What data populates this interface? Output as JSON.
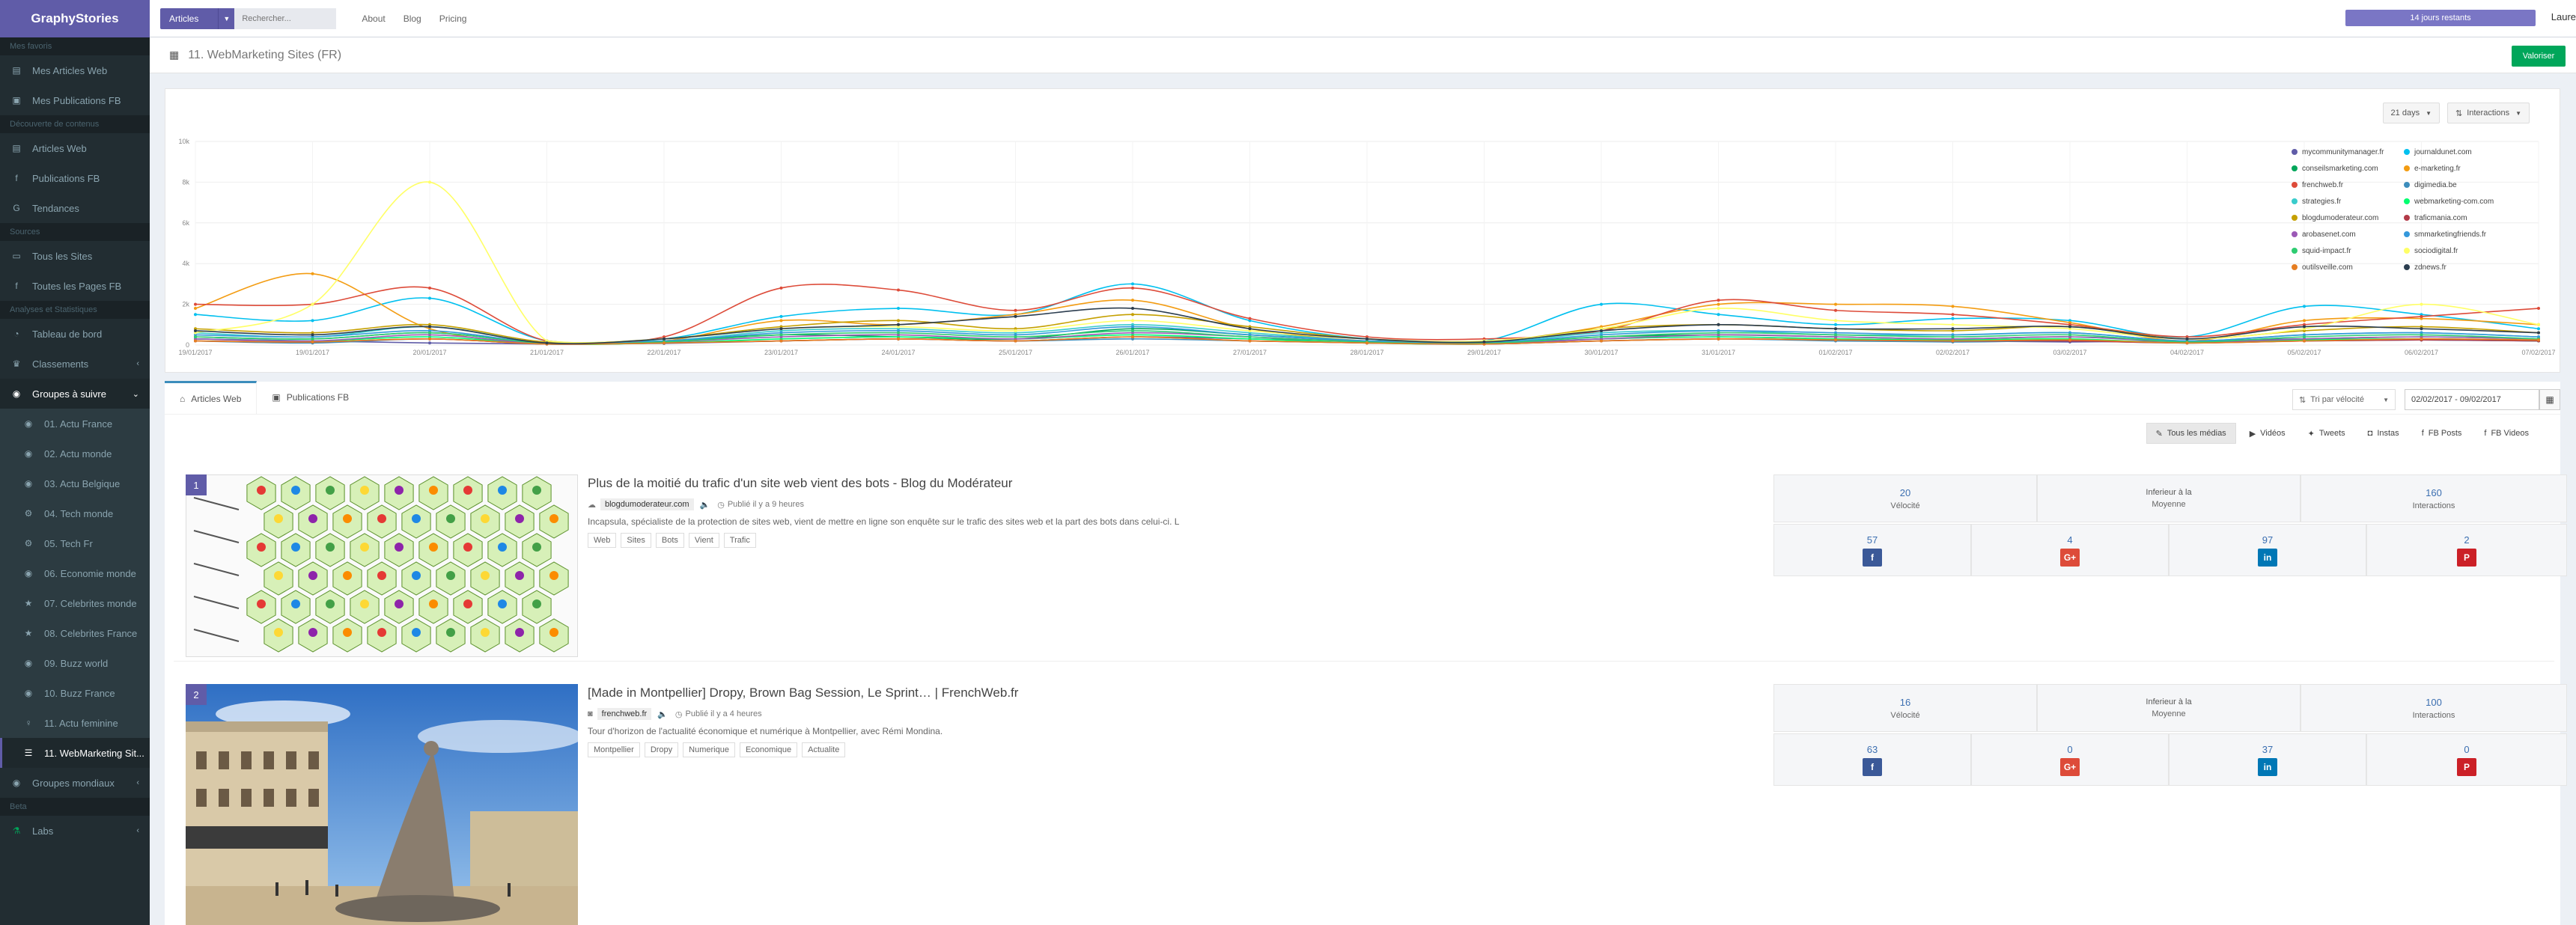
{
  "app": {
    "title": "GraphyStories"
  },
  "sidebar": {
    "sections": [
      {
        "header": "Mes favoris",
        "items": [
          {
            "label": "Mes Articles Web",
            "icon": "newspaper-icon"
          },
          {
            "label": "Mes Publications FB",
            "icon": "facebook-square-icon"
          }
        ]
      },
      {
        "header": "Découverte de contenus",
        "items": [
          {
            "label": "Articles Web",
            "icon": "newspaper-icon"
          },
          {
            "label": "Publications FB",
            "icon": "facebook-icon"
          },
          {
            "label": "Tendances",
            "icon": "google-icon"
          }
        ]
      },
      {
        "header": "Sources",
        "items": [
          {
            "label": "Tous les Sites",
            "icon": "monitor-icon"
          },
          {
            "label": "Toutes les Pages FB",
            "icon": "facebook-icon"
          }
        ]
      },
      {
        "header": "Analyses et Statistiques",
        "items": [
          {
            "label": "Tableau de bord",
            "icon": "dashboard-icon"
          },
          {
            "label": "Classements",
            "icon": "trophy-icon"
          },
          {
            "label": "Groupes à suivre",
            "icon": "globe-icon"
          }
        ]
      }
    ],
    "groups": [
      {
        "label": "01. Actu France",
        "icon": "globe-icon"
      },
      {
        "label": "02. Actu monde",
        "icon": "globe-icon"
      },
      {
        "label": "03. Actu Belgique",
        "icon": "globe-icon"
      },
      {
        "label": "04. Tech monde",
        "icon": "gear-icon"
      },
      {
        "label": "05. Tech Fr",
        "icon": "gear-icon"
      },
      {
        "label": "06. Economie monde",
        "icon": "globe-icon"
      },
      {
        "label": "07. Celebrites monde",
        "icon": "star-icon"
      },
      {
        "label": "08. Celebrites France",
        "icon": "star-icon"
      },
      {
        "label": "09. Buzz world",
        "icon": "globe-icon"
      },
      {
        "label": "10. Buzz France",
        "icon": "globe-icon"
      },
      {
        "label": "11. Actu feminine",
        "icon": "female-icon"
      },
      {
        "label": "11. WebMarketing Sit...",
        "icon": "list-icon"
      }
    ],
    "after": [
      {
        "label": "Groupes mondiaux",
        "icon": "globe-icon"
      }
    ],
    "beta_header": "Beta",
    "beta_items": [
      {
        "label": "Labs",
        "icon": "flask-icon"
      }
    ]
  },
  "topbar": {
    "dropdown_label": "Articles",
    "search_placeholder": "Rechercher...",
    "links": [
      "About",
      "Blog",
      "Pricing"
    ],
    "badge": "14 jours restants",
    "user": "Laure"
  },
  "page": {
    "title": "11. WebMarketing Sites (FR)",
    "valoriser": "Valoriser"
  },
  "chart_controls": {
    "range": "21 days",
    "metric": "Interactions"
  },
  "chart_data": {
    "type": "line",
    "x": [
      "19/01/2017",
      "19/01/2017",
      "20/01/2017",
      "21/01/2017",
      "22/01/2017",
      "23/01/2017",
      "24/01/2017",
      "25/01/2017",
      "26/01/2017",
      "27/01/2017",
      "28/01/2017",
      "29/01/2017",
      "30/01/2017",
      "31/01/2017",
      "01/02/2017",
      "02/02/2017",
      "03/02/2017",
      "04/02/2017",
      "05/02/2017",
      "06/02/2017",
      "07/02/2017"
    ],
    "yticks": [
      "0",
      "2k",
      "4k",
      "6k",
      "8k",
      "10k"
    ],
    "ylim": [
      0,
      10000
    ],
    "grid": true,
    "legend_placement": "top-right",
    "series": [
      {
        "name": "mycommunitymanager.fr",
        "color": "#605ca8",
        "values": [
          300,
          200,
          100,
          50,
          80,
          200,
          300,
          200,
          400,
          300,
          200,
          100,
          300,
          400,
          300,
          200,
          150,
          200,
          300,
          250,
          200
        ]
      },
      {
        "name": "journaldunet.com",
        "color": "#00c0ef",
        "values": [
          1500,
          1200,
          2300,
          200,
          300,
          1400,
          1800,
          1500,
          3000,
          1200,
          300,
          200,
          2000,
          1500,
          1000,
          1300,
          1200,
          400,
          1900,
          1500,
          800
        ]
      },
      {
        "name": "conseilsmarketing.com",
        "color": "#00a65a",
        "values": [
          400,
          300,
          600,
          100,
          200,
          500,
          400,
          300,
          800,
          500,
          200,
          100,
          400,
          500,
          400,
          300,
          400,
          200,
          300,
          400,
          300
        ]
      },
      {
        "name": "e-marketing.fr",
        "color": "#f39c12",
        "values": [
          1800,
          3500,
          800,
          100,
          200,
          1200,
          1000,
          1500,
          2200,
          800,
          200,
          100,
          900,
          2000,
          2000,
          1900,
          1100,
          200,
          1200,
          1300,
          1000
        ]
      },
      {
        "name": "frenchweb.fr",
        "color": "#dd4b39",
        "values": [
          2000,
          2000,
          2800,
          200,
          400,
          2800,
          2700,
          1700,
          2800,
          1300,
          400,
          300,
          700,
          2200,
          1700,
          1500,
          1000,
          400,
          1000,
          1400,
          1800
        ]
      },
      {
        "name": "digimedia.be",
        "color": "#3c8dbc",
        "values": [
          200,
          100,
          300,
          50,
          100,
          200,
          300,
          200,
          300,
          200,
          100,
          50,
          200,
          300,
          200,
          150,
          200,
          100,
          200,
          250,
          200
        ]
      },
      {
        "name": "strategies.fr",
        "color": "#39cccc",
        "values": [
          600,
          400,
          900,
          100,
          200,
          700,
          800,
          600,
          1000,
          600,
          200,
          100,
          600,
          700,
          500,
          500,
          600,
          200,
          500,
          600,
          400
        ]
      },
      {
        "name": "webmarketing-com.com",
        "color": "#01ff70",
        "values": [
          300,
          200,
          400,
          50,
          100,
          300,
          400,
          300,
          500,
          300,
          100,
          50,
          300,
          400,
          300,
          250,
          300,
          100,
          250,
          300,
          200
        ]
      },
      {
        "name": "blogdumoderateur.com",
        "color": "#c5a000",
        "values": [
          800,
          600,
          1000,
          150,
          300,
          900,
          1200,
          800,
          1500,
          900,
          300,
          150,
          800,
          1000,
          800,
          700,
          900,
          300,
          700,
          900,
          600
        ]
      },
      {
        "name": "traficmania.com",
        "color": "#b23a48",
        "values": [
          200,
          150,
          300,
          50,
          100,
          200,
          300,
          200,
          400,
          200,
          100,
          50,
          200,
          300,
          250,
          200,
          200,
          100,
          200,
          250,
          200
        ]
      },
      {
        "name": "arobasenet.com",
        "color": "#9b59b6",
        "values": [
          300,
          200,
          500,
          50,
          150,
          400,
          500,
          300,
          600,
          400,
          150,
          50,
          300,
          500,
          400,
          300,
          400,
          150,
          300,
          400,
          300
        ]
      },
      {
        "name": "smmarketingfriends.fr",
        "color": "#3498db",
        "values": [
          500,
          400,
          700,
          100,
          200,
          600,
          700,
          500,
          900,
          500,
          200,
          100,
          500,
          700,
          600,
          500,
          600,
          200,
          500,
          600,
          400
        ]
      },
      {
        "name": "squid-impact.fr",
        "color": "#2ecc71",
        "values": [
          400,
          300,
          600,
          80,
          150,
          500,
          600,
          400,
          700,
          400,
          150,
          80,
          400,
          600,
          500,
          400,
          500,
          150,
          400,
          500,
          300
        ]
      },
      {
        "name": "sociodigital.fr",
        "color": "#ffff66",
        "values": [
          600,
          2000,
          8000,
          200,
          300,
          800,
          900,
          700,
          1200,
          700,
          300,
          200,
          800,
          1800,
          1200,
          1000,
          800,
          300,
          800,
          2000,
          1000
        ]
      },
      {
        "name": "outilsveille.com",
        "color": "#e67e22",
        "values": [
          200,
          150,
          300,
          50,
          100,
          200,
          300,
          200,
          400,
          200,
          100,
          50,
          200,
          300,
          250,
          200,
          250,
          100,
          200,
          300,
          250
        ]
      },
      {
        "name": "zdnews.fr",
        "color": "#2c3e50",
        "values": [
          700,
          500,
          900,
          100,
          300,
          800,
          1000,
          1400,
          1800,
          800,
          300,
          150,
          700,
          1000,
          800,
          800,
          900,
          300,
          900,
          800,
          600
        ]
      }
    ]
  },
  "tabs": {
    "items": [
      {
        "label": "Articles Web",
        "icon": "home-icon"
      },
      {
        "label": "Publications FB",
        "icon": "facebook-square-icon"
      }
    ],
    "sort_label": "Tri par vélocité",
    "date_range": "02/02/2017 - 09/02/2017"
  },
  "filters": [
    {
      "label": "Tous les médias",
      "icon": "wrench-icon"
    },
    {
      "label": "Vidéos",
      "icon": "video-icon"
    },
    {
      "label": "Tweets",
      "icon": "twitter-icon"
    },
    {
      "label": "Instas",
      "icon": "instagram-icon"
    },
    {
      "label": "FB Posts",
      "icon": "facebook-icon"
    },
    {
      "label": "FB Videos",
      "icon": "facebook-icon"
    }
  ],
  "articles": [
    {
      "rank": "1",
      "title": "Plus de la moitié du trafic d'un site web vient des bots - Blog du Modérateur",
      "domain": "blogdumoderateur.com",
      "time": "Publié il y a 9 heures",
      "desc": "Incapsula, spécialiste de la protection de sites web, vient de mettre en ligne son enquête sur le trafic des sites web et la part des bots dans celui-ci. L",
      "tags": [
        "Web",
        "Sites",
        "Bots",
        "Vient",
        "Trafic"
      ],
      "velocite": "20",
      "velocite_label": "Vélocité",
      "moyenne": "Inferieur à la",
      "moyenne_label": "Moyenne",
      "interactions": "160",
      "interactions_label": "Interactions",
      "facebook": "57",
      "google": "4",
      "linkedin": "97",
      "pinterest": "2"
    },
    {
      "rank": "2",
      "title": "[Made in Montpellier] Dropy, Brown Bag Session, Le Sprint… | FrenchWeb.fr",
      "domain": "frenchweb.fr",
      "time": "Publié il y a 4 heures",
      "desc": "Tour d'horizon de l'actualité économique et numérique à Montpellier, avec Rémi Mondina.",
      "tags": [
        "Montpellier",
        "Dropy",
        "Numerique",
        "Economique",
        "Actualite"
      ],
      "velocite": "16",
      "velocite_label": "Vélocité",
      "moyenne": "Inferieur à la",
      "moyenne_label": "Moyenne",
      "interactions": "100",
      "interactions_label": "Interactions",
      "facebook": "63",
      "google": "0",
      "linkedin": "37",
      "pinterest": "0"
    }
  ],
  "colors": {
    "brand": "#605ca8",
    "sidebar": "#222d32",
    "success": "#00a65a",
    "facebook": "#3b5998",
    "google": "#dd4b39",
    "linkedin": "#0077b5",
    "pinterest": "#cb2027"
  }
}
